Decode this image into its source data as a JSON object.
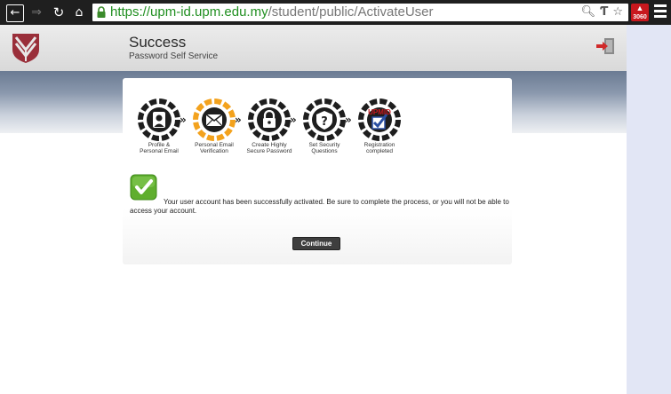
{
  "browser": {
    "url_host": "https://upm-id.upm.edu.my",
    "url_path": "/student/public/ActivateUser",
    "extension_badge": "3060"
  },
  "header": {
    "title": "Success",
    "subtitle": "Password Self Service"
  },
  "steps": [
    {
      "label_line1": "Profile &",
      "label_line2": "Personal Email",
      "icon": "profile-icon"
    },
    {
      "label_line1": "Personal Email",
      "label_line2": "Verification",
      "icon": "email-icon"
    },
    {
      "label_line1": "Create Highly",
      "label_line2": "Secure Password",
      "icon": "lock-icon"
    },
    {
      "label_line1": "Set Security",
      "label_line2": "Questions",
      "icon": "question-icon"
    },
    {
      "label_line1": "Registration",
      "label_line2": "completed",
      "icon": "upmid-check-icon",
      "badge": "UPMID"
    }
  ],
  "message": "Your user account has been successfully activated. Be sure to complete the process, or you will not be able to access your account.",
  "continue_label": "Continue",
  "colors": {
    "chrome_bg": "#1f1f1f",
    "url_green": "#218f21",
    "active_step": "#f3a21d",
    "success_green": "#5fae2e",
    "button_bg": "#3e3e3e",
    "side_strip": "#e2e6f5"
  }
}
